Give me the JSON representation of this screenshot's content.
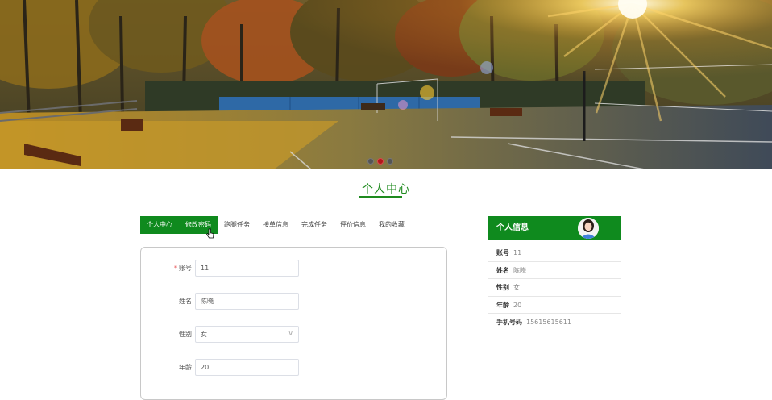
{
  "banner": {
    "carousel_dots": 3,
    "active_dot": 1
  },
  "page": {
    "title": "个人中心"
  },
  "tabs": [
    {
      "label": "个人中心",
      "active": true
    },
    {
      "label": "修改密码",
      "hover": true
    },
    {
      "label": "跑腿任务"
    },
    {
      "label": "接单信息"
    },
    {
      "label": "完成任务"
    },
    {
      "label": "评价信息"
    },
    {
      "label": "我的收藏"
    }
  ],
  "form": {
    "account": {
      "label": "账号",
      "required_mark": "*",
      "value": "11"
    },
    "name": {
      "label": "姓名",
      "value": "陈晓"
    },
    "gender": {
      "label": "性别",
      "value": "女",
      "chevron": "∨"
    },
    "age": {
      "label": "年龄",
      "value": "20"
    }
  },
  "info": {
    "title": "个人信息",
    "rows": [
      {
        "key": "账号",
        "value": "11"
      },
      {
        "key": "姓名",
        "value": "陈晓"
      },
      {
        "key": "性别",
        "value": "女"
      },
      {
        "key": "年龄",
        "value": "20"
      },
      {
        "key": "手机号码",
        "value": "15615615611"
      }
    ]
  },
  "colors": {
    "primary_green": "#0f8a1e",
    "title_green": "#1e8a1e",
    "active_dot": "#b3161b"
  }
}
